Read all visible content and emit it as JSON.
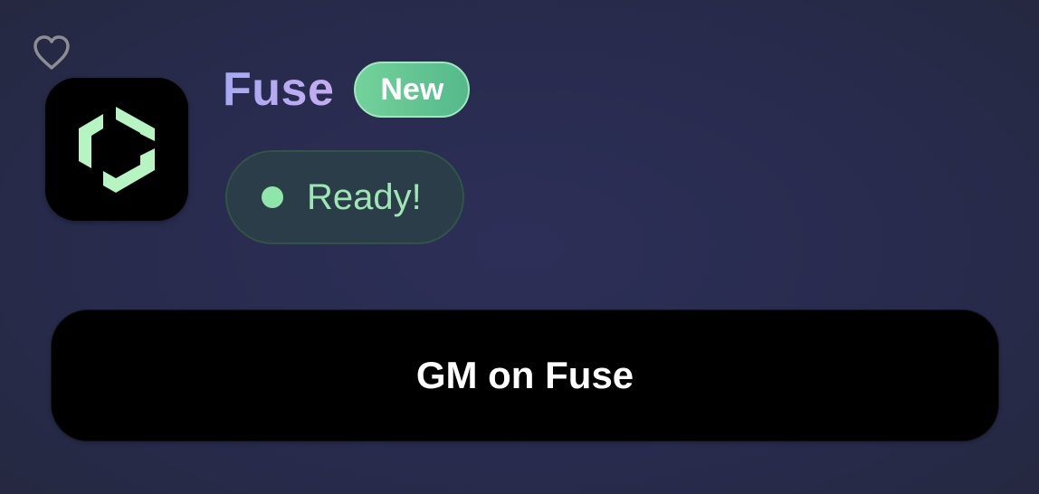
{
  "favorite": {
    "icon": "heart-outline-icon",
    "color": "#8d8d95"
  },
  "app": {
    "icon": "fuse-logo-icon",
    "icon_color": "#b6f5c2",
    "name": "Fuse",
    "badge": "New",
    "status": "Ready!",
    "status_dot_color": "#8ee6a9"
  },
  "action": {
    "button_label": "GM on Fuse"
  }
}
